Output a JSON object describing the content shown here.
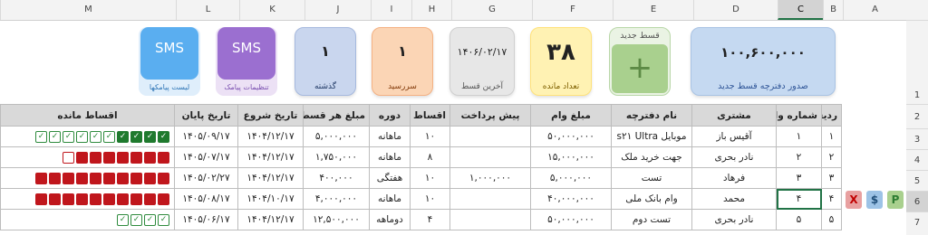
{
  "columns": [
    "A",
    "B",
    "C",
    "D",
    "E",
    "F",
    "G",
    "H",
    "I",
    "J",
    "K",
    "L",
    "M"
  ],
  "selected_column": "C",
  "rows": [
    "1",
    "2",
    "3",
    "4",
    "5",
    "6",
    "7"
  ],
  "selected_row": "6",
  "tiles": {
    "loan_amount": {
      "value": "۱۰۰,۶۰۰,۰۰۰",
      "label": "صدور دفترچه قسط جدید"
    },
    "new_installment": {
      "title": "قسط جدید",
      "symbol": "+"
    },
    "remaining_count": {
      "value": "۳۸",
      "label": "تعداد مانده"
    },
    "last_installment": {
      "value": "۱۴۰۶/۰۲/۱۷",
      "label": "آخرین قسط"
    },
    "due": {
      "value": "۱",
      "label": "سررسید"
    },
    "overdue": {
      "value": "۱",
      "label": "گذشته"
    },
    "sms_settings": {
      "value": "SMS",
      "label": "تنظیمات پیامک"
    },
    "sms_list": {
      "value": "SMS",
      "label": "لیست پیامکها"
    }
  },
  "table": {
    "headers": [
      "ردیف",
      "شماره وام",
      "مشتری",
      "نام دفترچه",
      "مبلغ وام",
      "پیش پرداخت",
      "اقساط",
      "دوره",
      "مبلغ هر قسط",
      "تاریخ شروع",
      "تاریخ پایان",
      "اقساط مانده"
    ],
    "rows": [
      {
        "cells": [
          "۱",
          "۱",
          "آقیس باز",
          "موبایل s۲۱ Ultra",
          "۵۰,۰۰۰,۰۰۰",
          "",
          "۱۰",
          "ماهانه",
          "۵,۰۰۰,۰۰۰",
          "۱۴۰۴/۱۲/۱۷",
          "۱۴۰۵/۰۹/۱۷"
        ],
        "checks": [
          "g",
          "g",
          "g",
          "g",
          "e",
          "e",
          "e",
          "e",
          "e",
          "e"
        ]
      },
      {
        "cells": [
          "۲",
          "۲",
          "نادر بحری",
          "جهت خرید ملک",
          "۱۵,۰۰۰,۰۰۰",
          "",
          "۸",
          "ماهانه",
          "۱,۷۵۰,۰۰۰",
          "۱۴۰۴/۱۲/۱۷",
          "۱۴۰۵/۰۷/۱۷"
        ],
        "checks": [
          "r",
          "r",
          "r",
          "r",
          "r",
          "r",
          "r",
          "w"
        ]
      },
      {
        "cells": [
          "۳",
          "۳",
          "فرهاد",
          "تست",
          "۵,۰۰۰,۰۰۰",
          "۱,۰۰۰,۰۰۰",
          "۱۰",
          "هفتگی",
          "۴۰۰,۰۰۰",
          "۱۴۰۴/۱۲/۱۷",
          "۱۴۰۵/۰۲/۲۷"
        ],
        "checks": [
          "r",
          "r",
          "r",
          "r",
          "r",
          "r",
          "r",
          "r",
          "r",
          "r"
        ]
      },
      {
        "cells": [
          "۴",
          "۴",
          "محمد",
          "وام بانک ملی",
          "۴۰,۰۰۰,۰۰۰",
          "",
          "۱۰",
          "ماهانه",
          "۴,۰۰۰,۰۰۰",
          "۱۴۰۴/۱۰/۱۷",
          "۱۴۰۵/۰۸/۱۷"
        ],
        "checks": [
          "r",
          "r",
          "r",
          "r",
          "r",
          "r",
          "r",
          "r",
          "r",
          "r"
        ]
      },
      {
        "cells": [
          "۵",
          "۵",
          "نادر بحری",
          "تست دوم",
          "۵۰,۰۰۰,۰۰۰",
          "",
          "۴",
          "دوماهه",
          "۱۲,۵۰۰,۰۰۰",
          "۱۴۰۴/۱۲/۱۷",
          "۱۴۰۵/۰۶/۱۷"
        ],
        "checks": [
          "e",
          "e",
          "e",
          "e"
        ]
      }
    ]
  },
  "row_actions": {
    "delete": "X",
    "pay_money": "$",
    "paid": "P"
  },
  "colors": {
    "excel_green": "#217346",
    "paid_green": "#1f7a2e",
    "overdue_red": "#c0161c"
  }
}
